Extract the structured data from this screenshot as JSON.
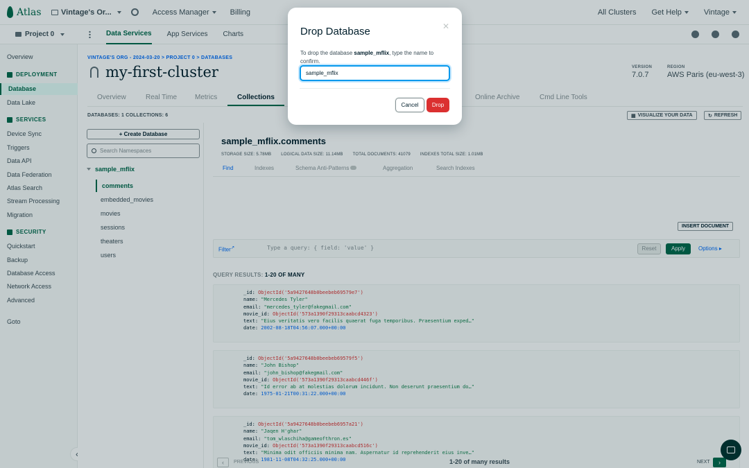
{
  "topbar": {
    "brand": "Atlas",
    "org": "Vintage's Or...",
    "links": [
      "Access Manager",
      "Billing"
    ],
    "right": [
      "All Clusters",
      "Get Help",
      "Vintage"
    ]
  },
  "subbar": {
    "project": "Project 0",
    "tabs": [
      "Data Services",
      "App Services",
      "Charts"
    ]
  },
  "sidebar": {
    "overview": "Overview",
    "deployment": "DEPLOYMENT",
    "database": "Database",
    "data_lake": "Data Lake",
    "services": "SERVICES",
    "device_sync": "Device Sync",
    "triggers": "Triggers",
    "data_api": "Data API",
    "data_federation": "Data Federation",
    "atlas_search": "Atlas Search",
    "stream_processing": "Stream Processing",
    "migration": "Migration",
    "security": "SECURITY",
    "quickstart": "Quickstart",
    "backup": "Backup",
    "database_access": "Database Access",
    "network_access": "Network Access",
    "advanced": "Advanced",
    "goto": "Goto"
  },
  "cluster": {
    "breadcrumb": "VINTAGE'S ORG - 2024-03-20 > PROJECT 0 > DATABASES",
    "name": "my-first-cluster",
    "version_label": "VERSION",
    "version": "7.0.7",
    "region_label": "REGION",
    "region": "AWS Paris (eu-west-3)",
    "tabs": [
      "Overview",
      "Real Time",
      "Metrics",
      "Collections",
      "Online Archive",
      "Cmd Line Tools"
    ],
    "counts": "DATABASES: 1   COLLECTIONS: 6",
    "visualize": "VISUALIZE YOUR DATA",
    "refresh": "REFRESH"
  },
  "namespaces": {
    "create_db": "+ Create Database",
    "search_placeholder": "Search Namespaces",
    "db": "sample_mflix",
    "collections": [
      "comments",
      "embedded_movies",
      "movies",
      "sessions",
      "theaters",
      "users"
    ]
  },
  "collection": {
    "title": "sample_mflix.comments",
    "stats": [
      "STORAGE SIZE: 5.78MB",
      "LOGICAL DATA SIZE: 11.14MB",
      "TOTAL DOCUMENTS: 41079",
      "INDEXES TOTAL SIZE: 1.01MB"
    ],
    "tabs": [
      "Find",
      "Indexes",
      "Schema Anti-Patterns",
      "Aggregation",
      "Search Indexes"
    ],
    "insert": "INSERT DOCUMENT",
    "filter": "Filter",
    "query_placeholder": "Type a query: { field: 'value' }",
    "reset": "Reset",
    "apply": "Apply",
    "options": "Options",
    "results_prefix": "QUERY RESULTS:",
    "results_range": "1-20 OF MANY"
  },
  "documents": [
    {
      "id": "ObjectId('5a9427648b0beebeb69579e7')",
      "name": "\"Mercedes Tyler\"",
      "email": "\"mercedes_tyler@fakegmail.com\"",
      "movie_id": "ObjectId('573a1390f29313caabcd4323')",
      "text": "\"Eius veritatis vero facilis quaerat fuga temporibus. Praesentium exped…\"",
      "date": "2002-08-18T04:56:07.000+00:00"
    },
    {
      "id": "ObjectId('5a9427648b0beebeb69579f5')",
      "name": "\"John Bishop\"",
      "email": "\"john_bishop@fakegmail.com\"",
      "movie_id": "ObjectId('573a1390f29313caabcd446f')",
      "text": "\"Id error ab at molestias dolorum incidunt. Non deserunt praesentium do…\"",
      "date": "1975-01-21T00:31:22.000+00:00"
    },
    {
      "id": "ObjectId('5a9427648b0beebeb6957a21')",
      "name": "\"Jaqen H'ghar\"",
      "email": "\"tom_wlaschiha@gameofthron.es\"",
      "movie_id": "ObjectId('573a1390f29313caabcd516c')",
      "text": "\"Minima odit officiis minima nam. Aspernatur id reprehenderit eius inve…\"",
      "date": "1981-11-08T04:32:25.000+00:00"
    }
  ],
  "pager": {
    "previous": "PREVIOUS",
    "info": "1-20 of many results",
    "next": "NEXT"
  },
  "modal": {
    "title": "Drop Database",
    "text_before": "To drop the database ",
    "db_name": "sample_mflix",
    "text_after": ", type the name to confirm.",
    "input_value": "sample_mflix",
    "cancel": "Cancel",
    "drop": "Drop"
  },
  "colors": {
    "brand_green": "#00684a",
    "danger_red": "#db3030",
    "link_blue": "#016bf8"
  }
}
